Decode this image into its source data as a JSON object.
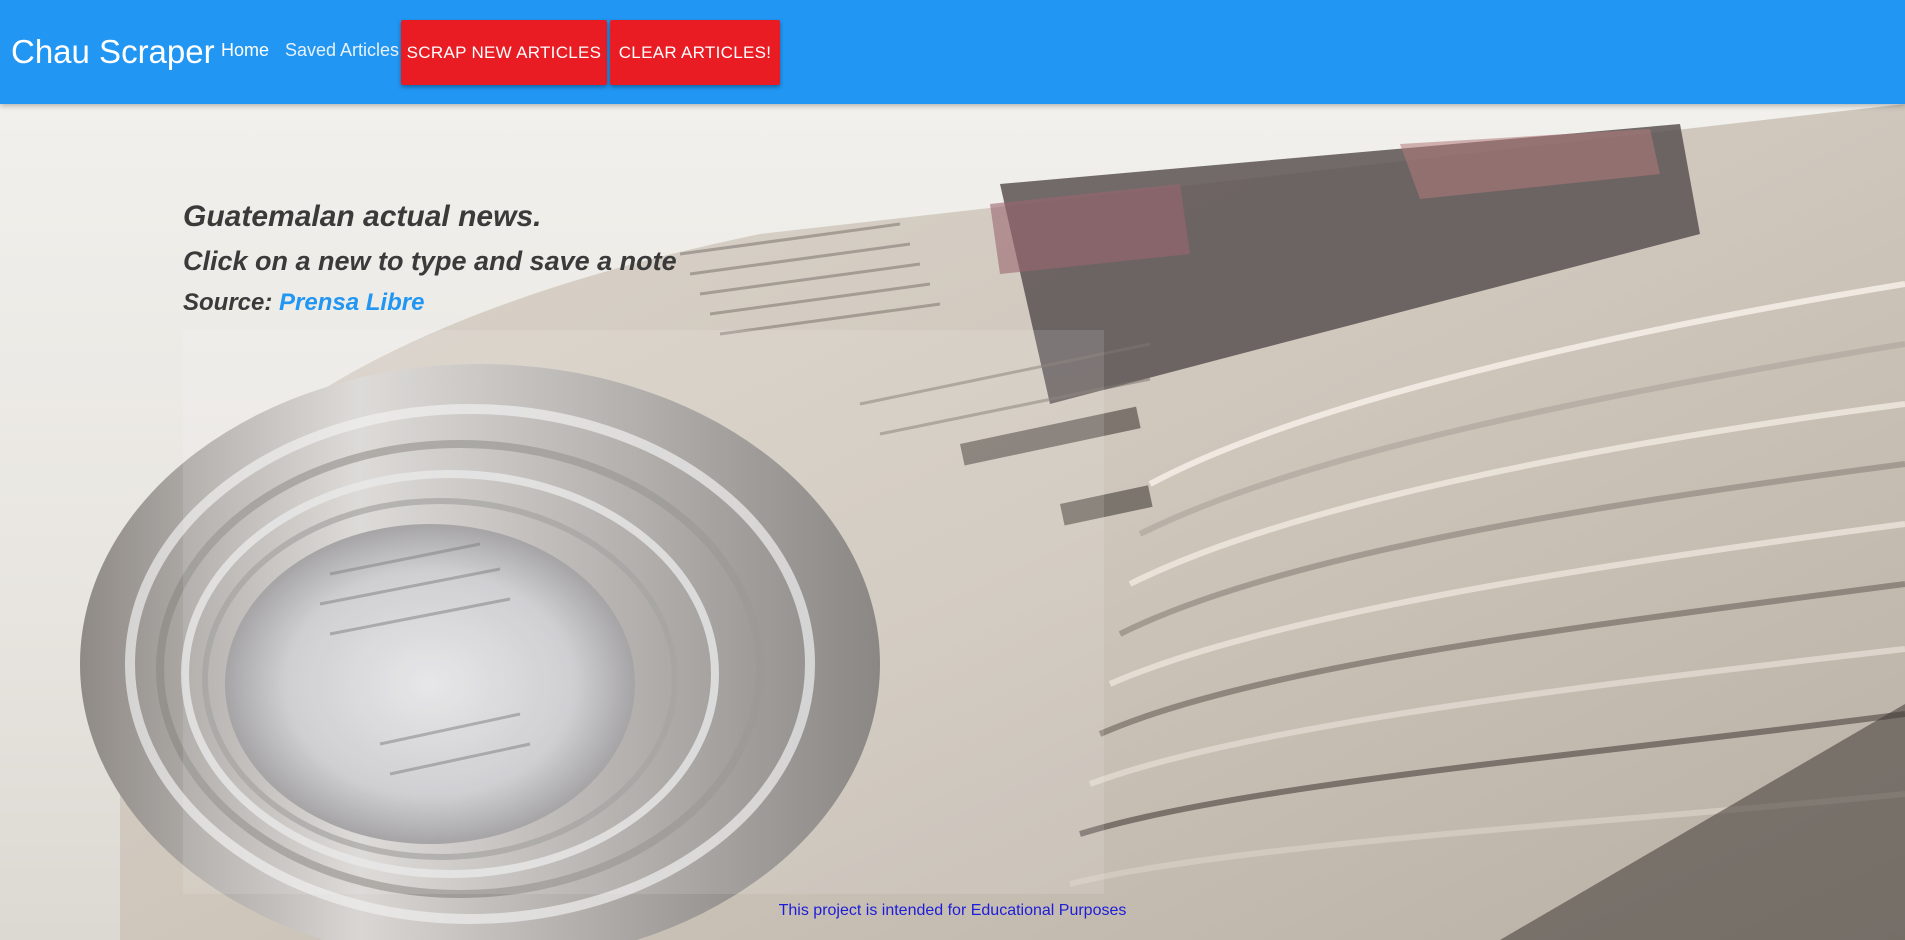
{
  "navbar": {
    "brand": "Chau Scraper",
    "links": {
      "home": "Home",
      "saved": "Saved Articles"
    },
    "buttons": {
      "scrape": "SCRAP NEW ARTICLES",
      "clear": "CLEAR ARTICLES!"
    },
    "colors": {
      "bar": "#2196f3",
      "button": "#e91c24"
    }
  },
  "hero": {
    "headline": "Guatemalan actual news.",
    "subhead": "Click on a new to type and save a note",
    "source_label": "Source:",
    "source_link": "Prensa Libre",
    "background_icon": "rolled-newspaper-image"
  },
  "footer": {
    "note": "This project is intended for Educational Purposes"
  }
}
